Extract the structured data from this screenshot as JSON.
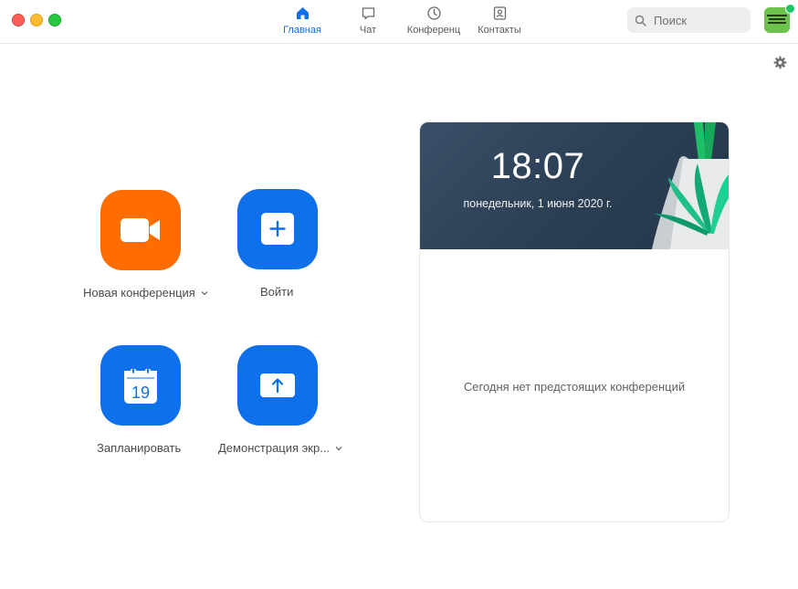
{
  "nav": {
    "tabs": [
      {
        "label": "Главная",
        "icon": "home-icon",
        "active": true
      },
      {
        "label": "Чат",
        "icon": "chat-icon",
        "active": false
      },
      {
        "label": "Конференц",
        "icon": "clock-icon",
        "active": false
      },
      {
        "label": "Контакты",
        "icon": "contacts-icon",
        "active": false
      }
    ]
  },
  "search": {
    "placeholder": "Поиск"
  },
  "actions": {
    "new_meeting": "Новая конференция",
    "join": "Войти",
    "schedule": "Запланировать",
    "schedule_day": "19",
    "share_screen": "Демонстрация экр..."
  },
  "calendar": {
    "time": "18:07",
    "date": "понедельник, 1 июня 2020 г.",
    "empty_message": "Сегодня нет предстоящих конференций"
  },
  "colors": {
    "accent_blue": "#0e71eb",
    "orange": "#ff6c00",
    "presence_green": "#19c865"
  }
}
